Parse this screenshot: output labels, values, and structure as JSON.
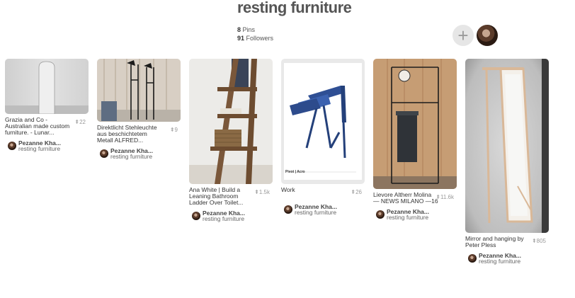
{
  "board": {
    "title": "resting furniture",
    "pins_count": "8",
    "pins_label": "Pins",
    "followers_count": "91",
    "followers_label": "Followers"
  },
  "actions": {
    "add_label": "+"
  },
  "pins": [
    {
      "desc": "Grazia and Co - Australian made custom furniture. - Lunar...",
      "repins": "22",
      "user": "Pezanne Kha...",
      "board": "resting furniture"
    },
    {
      "desc": "Direktlicht Stehleuchte aus beschichtetem Metall ALFRED...",
      "repins": "9",
      "user": "Pezanne Kha...",
      "board": "resting furniture"
    },
    {
      "desc": "Ana White | Build a Leaning Bathroom Ladder Over Toilet...",
      "repins": "1.5k",
      "user": "Pezanne Kha...",
      "board": "resting furniture"
    },
    {
      "desc": "Work",
      "repins": "26",
      "user": "Pezanne Kha...",
      "board": "resting furniture",
      "image_caption": "Pivot | Acro"
    },
    {
      "desc": "Lievore Altherr Molina — NEWS MILANO —16",
      "repins": "11.6k",
      "user": "Pezanne Kha...",
      "board": "resting furniture"
    },
    {
      "desc": "Mirror and hanging by Peter Pless",
      "repins": "805",
      "user": "Pezanne Kha...",
      "board": "resting furniture"
    }
  ]
}
